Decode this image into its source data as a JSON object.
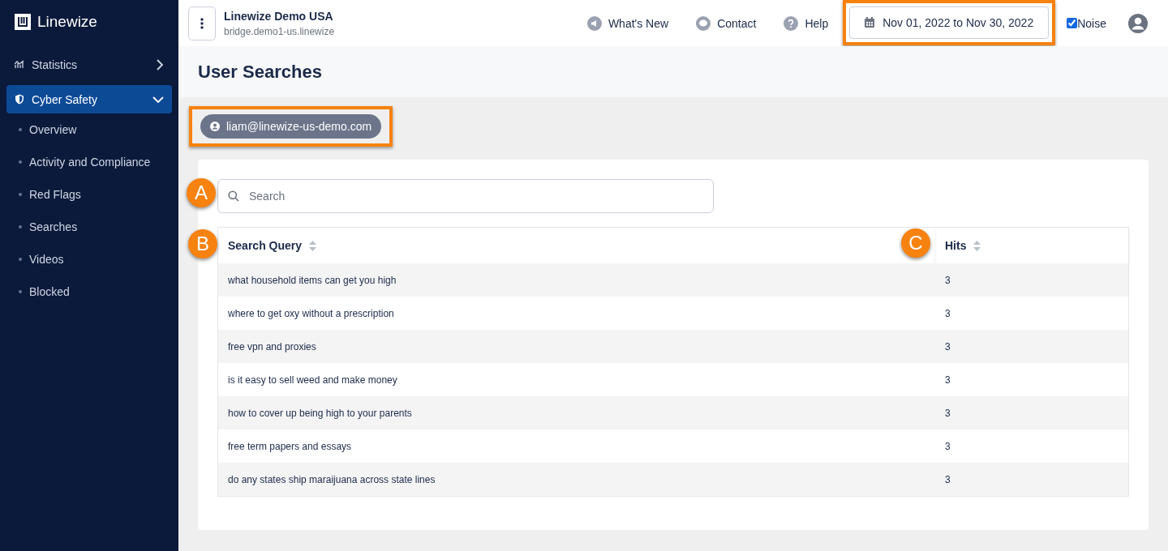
{
  "sidebar": {
    "logo": "Linewize",
    "items": [
      {
        "label": "Statistics",
        "kind": "section",
        "selected": false,
        "expanded": false
      },
      {
        "label": "Cyber Safety",
        "kind": "section",
        "selected": true,
        "expanded": true,
        "children": [
          {
            "label": "Overview",
            "selected": false
          },
          {
            "label": "Activity and Compliance",
            "selected": false
          },
          {
            "label": "Red Flags",
            "selected": false
          },
          {
            "label": "Searches",
            "selected": false
          },
          {
            "label": "Videos",
            "selected": false
          },
          {
            "label": "Blocked",
            "selected": false
          }
        ]
      }
    ]
  },
  "topbar": {
    "org_name": "Linewize Demo USA",
    "host": "bridge.demo1-us.linewize",
    "links": [
      {
        "label": "What's New",
        "kind": "news"
      },
      {
        "label": "Contact",
        "kind": "chat"
      },
      {
        "label": "Help",
        "kind": "help"
      }
    ],
    "date_range": "Nov 01, 2022 to Nov 30, 2022",
    "date_highlighted": true,
    "noise": {
      "label": "Noise",
      "checked": true
    }
  },
  "page_title": "User Searches",
  "user_chip": {
    "label": "liam@linewize-us-demo.com",
    "highlighted": true
  },
  "markers": [
    "A",
    "B",
    "C"
  ],
  "search": {
    "placeholder": "Search"
  },
  "table": {
    "columns": [
      "Search Query",
      "Hits"
    ],
    "rows": [
      [
        "what household items can get you high",
        "3"
      ],
      [
        "where to get oxy without a prescription",
        "3"
      ],
      [
        "free vpn and proxies",
        "3"
      ],
      [
        "is it easy to sell weed and make money",
        "3"
      ],
      [
        "how to cover up being high to your parents",
        "3"
      ],
      [
        "free term papers and essays",
        "3"
      ],
      [
        "do any states ship maraijuana across state lines",
        "3"
      ]
    ]
  }
}
